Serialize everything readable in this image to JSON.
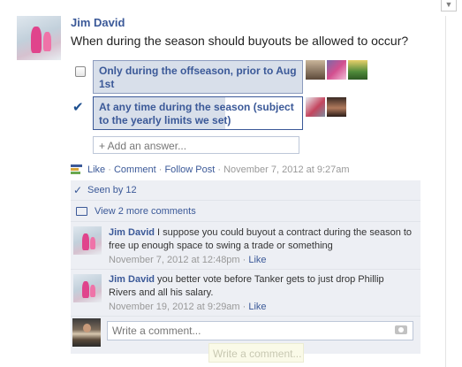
{
  "post": {
    "author": "Jim David",
    "question": "When during the season should buyouts be allowed to occur?",
    "options": [
      {
        "label": "Only during the offseason, prior to Aug 1st",
        "checked": false,
        "fill": 1.0,
        "voters": 3
      },
      {
        "label": "At any time during the season (subject to the yearly limits we set)",
        "checked": true,
        "fill": 0.63,
        "voters": 2
      }
    ],
    "add_answer_placeholder": "+ Add an answer...",
    "actions": {
      "like": "Like",
      "comment": "Comment",
      "follow": "Follow Post",
      "separator": " · ",
      "timestamp": "November 7, 2012 at 9:27am"
    }
  },
  "ufi": {
    "seen_by": "Seen by 12",
    "view_more": "View 2 more comments",
    "comments": [
      {
        "author": "Jim David",
        "text": " I suppose you could buyout a contract during the season to free up enough space to swing a trade or something",
        "timestamp": "November 7, 2012 at 12:48pm",
        "separator": " · ",
        "like": "Like"
      },
      {
        "author": "Jim David",
        "text": " you better vote before Tanker gets to just drop Phillip Rivers and all his salary.",
        "timestamp": "November 19, 2012 at 9:29am",
        "separator": " · ",
        "like": "Like"
      }
    ],
    "write_placeholder": "Write a comment...",
    "ghost_placeholder": "Write a comment..."
  },
  "icons": {
    "menu": "chevron-down-icon",
    "poll": "poll-icon",
    "seen": "checkmark-icon",
    "comments": "comment-bubble-icon",
    "camera": "camera-icon"
  },
  "colors": {
    "link": "#3b5998",
    "ufi_background": "#edeff4",
    "option_fill": "#d8dfea"
  }
}
